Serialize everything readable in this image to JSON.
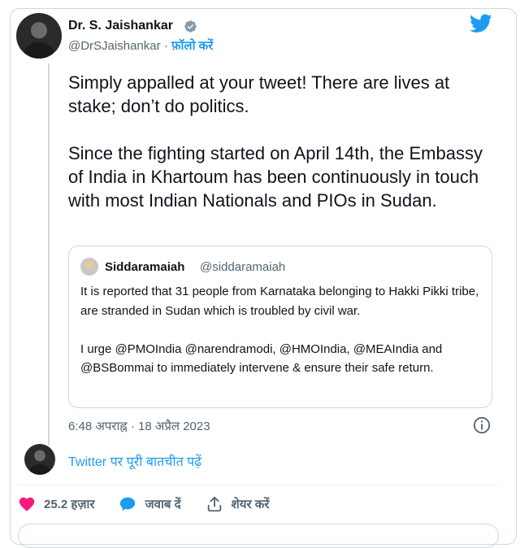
{
  "author": {
    "name": "Dr. S. Jaishankar",
    "handle": "@DrSJaishankar",
    "separator": "·",
    "follow_label": "फ़ॉलो करें"
  },
  "tweet": {
    "text": "Simply appalled at your tweet! There are lives at stake; don’t do politics.\n\nSince the fighting started on April 14th, the Embassy of India in Khartoum has been continuously in touch with most Indian Nationals and PIOs in Sudan.",
    "timestamp": "6:48 अपराह्न · 18 अप्रैल 2023"
  },
  "quote": {
    "name": "Siddaramaiah",
    "handle": "@siddaramaiah",
    "text": "It is reported that 31 people from Karnataka belonging to Hakki Pikki tribe, are stranded in Sudan which is troubled by civil war.\n\nI urge @PMOIndia @narendramodi, @HMOIndia, @MEAIndia and @BSBommai to immediately intervene & ensure their safe return."
  },
  "conversation_link": "Twitter पर पूरी बातचीत पढ़ें",
  "actions": {
    "like_count": "25.2 हज़ार",
    "reply_label": "जवाब दें",
    "share_label": "शेयर करें"
  },
  "icons": {
    "verified": "verified-badge-icon",
    "twitter": "twitter-bird-icon",
    "info": "info-icon",
    "like": "heart-icon",
    "reply": "speech-bubble-icon",
    "share": "share-upload-icon"
  },
  "colors": {
    "accent": "#1d9bf0",
    "like": "#f91880",
    "text": "#0f1419",
    "muted": "#536471",
    "border": "#cfd9de"
  }
}
